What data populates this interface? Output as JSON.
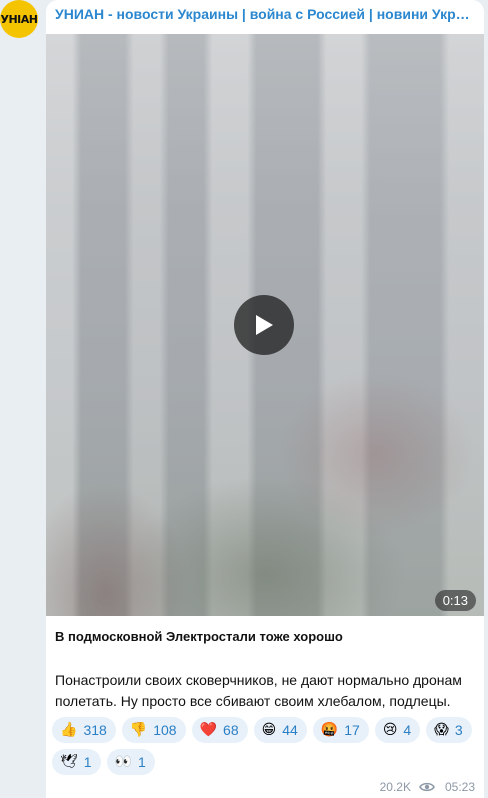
{
  "channel": {
    "name": "УНИАН - новости Украины | война с Россией | новини України | війна з Росією",
    "avatar_text": "УНIАН"
  },
  "video": {
    "duration": "0:13"
  },
  "post": {
    "title": "В подмосковной Электростали тоже хорошо",
    "body": "Понастроили своих сковерчников, не дают нормально дронам полетать. Ну просто все сбивают своим хлебалом, подлецы."
  },
  "reactions": [
    {
      "emoji": "👍",
      "count": "318"
    },
    {
      "emoji": "👎",
      "count": "108"
    },
    {
      "emoji": "❤️",
      "count": "68"
    },
    {
      "emoji": "😁",
      "count": "44"
    },
    {
      "emoji": "🤬",
      "count": "17"
    },
    {
      "emoji": "😢",
      "count": "4"
    },
    {
      "emoji": "😱",
      "count": "3"
    },
    {
      "emoji": "🕊",
      "count": "1"
    },
    {
      "emoji": "👀",
      "count": "1"
    }
  ],
  "meta": {
    "views": "20.2K",
    "time": "05:23",
    "views_icon": "eye-icon"
  },
  "colors": {
    "accent": "#2b87cf",
    "reaction_bg": "#e8f1fa",
    "page_bg": "#e9eef3"
  }
}
